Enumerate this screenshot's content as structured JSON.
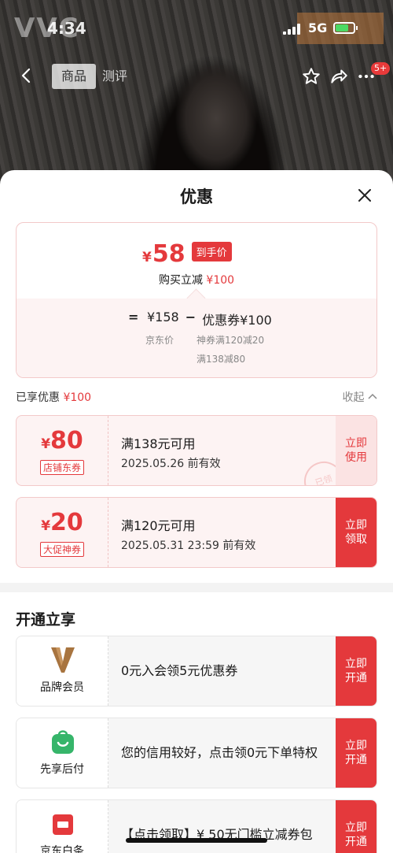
{
  "status": {
    "brand_overlay": "VVC",
    "time": "4:34",
    "network": "5G"
  },
  "nav": {
    "tab_product": "商品",
    "tab_review": "测评",
    "cart_badge": "5+"
  },
  "sheet": {
    "title": "优惠",
    "price": {
      "currency": "¥",
      "final_price": "58",
      "final_tag": "到手价",
      "instant_reduction_label": "购买立减",
      "instant_reduction_value": "¥100",
      "calc_equals": "=",
      "jd_price": "¥158",
      "calc_minus": "−",
      "coupon_total": "优惠券¥100",
      "jd_price_label": "京东价",
      "coupon_detail_1": "神券满120减20",
      "coupon_detail_2": "满138减80"
    },
    "enjoyed_label": "已享优惠",
    "enjoyed_value": "¥100",
    "collapse_label": "收起",
    "coupons": [
      {
        "currency": "¥",
        "amount": "80",
        "type": "店铺东券",
        "condition": "满138元可用",
        "valid": "2025.05.26 前有效",
        "button": "立即\n使用",
        "stamp": "已领"
      },
      {
        "currency": "¥",
        "amount": "20",
        "type": "大促神券",
        "condition": "满120元可用",
        "valid": "2025.05.31 23:59 前有效",
        "button": "立即\n领取"
      }
    ],
    "section_title": "开通立享",
    "members": [
      {
        "icon": "brand-v-icon",
        "label": "品牌会员",
        "text": "0元入会领5元优惠券",
        "button": "立即\n开通"
      },
      {
        "icon": "shopping-bag-icon",
        "label": "先享后付",
        "text": "您的信用较好，点击领0元下单特权",
        "button": "立即\n开通"
      },
      {
        "icon": "baitiao-icon",
        "label": "京东白条",
        "text": "【点击领取】¥ 50无门槛立减券包",
        "button": "立即\n开通"
      }
    ]
  },
  "colors": {
    "accent": "#e4393c",
    "coupon_bg": "#fdf3f3",
    "border_pink": "#f3c9c9"
  }
}
